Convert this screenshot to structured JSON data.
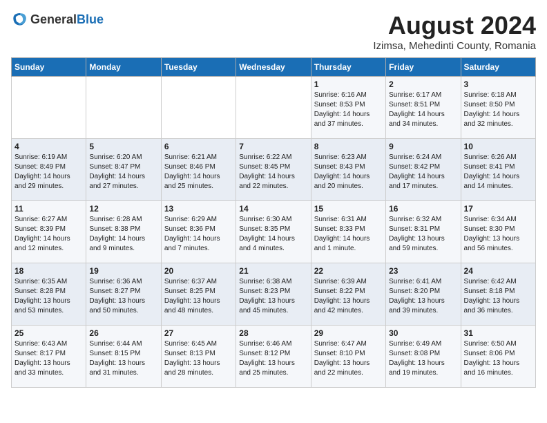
{
  "header": {
    "logo_general": "General",
    "logo_blue": "Blue",
    "title": "August 2024",
    "location": "Izimsa, Mehedinti County, Romania"
  },
  "days_of_week": [
    "Sunday",
    "Monday",
    "Tuesday",
    "Wednesday",
    "Thursday",
    "Friday",
    "Saturday"
  ],
  "weeks": [
    [
      {
        "day": "",
        "content": ""
      },
      {
        "day": "",
        "content": ""
      },
      {
        "day": "",
        "content": ""
      },
      {
        "day": "",
        "content": ""
      },
      {
        "day": "1",
        "content": "Sunrise: 6:16 AM\nSunset: 8:53 PM\nDaylight: 14 hours\nand 37 minutes."
      },
      {
        "day": "2",
        "content": "Sunrise: 6:17 AM\nSunset: 8:51 PM\nDaylight: 14 hours\nand 34 minutes."
      },
      {
        "day": "3",
        "content": "Sunrise: 6:18 AM\nSunset: 8:50 PM\nDaylight: 14 hours\nand 32 minutes."
      }
    ],
    [
      {
        "day": "4",
        "content": "Sunrise: 6:19 AM\nSunset: 8:49 PM\nDaylight: 14 hours\nand 29 minutes."
      },
      {
        "day": "5",
        "content": "Sunrise: 6:20 AM\nSunset: 8:47 PM\nDaylight: 14 hours\nand 27 minutes."
      },
      {
        "day": "6",
        "content": "Sunrise: 6:21 AM\nSunset: 8:46 PM\nDaylight: 14 hours\nand 25 minutes."
      },
      {
        "day": "7",
        "content": "Sunrise: 6:22 AM\nSunset: 8:45 PM\nDaylight: 14 hours\nand 22 minutes."
      },
      {
        "day": "8",
        "content": "Sunrise: 6:23 AM\nSunset: 8:43 PM\nDaylight: 14 hours\nand 20 minutes."
      },
      {
        "day": "9",
        "content": "Sunrise: 6:24 AM\nSunset: 8:42 PM\nDaylight: 14 hours\nand 17 minutes."
      },
      {
        "day": "10",
        "content": "Sunrise: 6:26 AM\nSunset: 8:41 PM\nDaylight: 14 hours\nand 14 minutes."
      }
    ],
    [
      {
        "day": "11",
        "content": "Sunrise: 6:27 AM\nSunset: 8:39 PM\nDaylight: 14 hours\nand 12 minutes."
      },
      {
        "day": "12",
        "content": "Sunrise: 6:28 AM\nSunset: 8:38 PM\nDaylight: 14 hours\nand 9 minutes."
      },
      {
        "day": "13",
        "content": "Sunrise: 6:29 AM\nSunset: 8:36 PM\nDaylight: 14 hours\nand 7 minutes."
      },
      {
        "day": "14",
        "content": "Sunrise: 6:30 AM\nSunset: 8:35 PM\nDaylight: 14 hours\nand 4 minutes."
      },
      {
        "day": "15",
        "content": "Sunrise: 6:31 AM\nSunset: 8:33 PM\nDaylight: 14 hours\nand 1 minute."
      },
      {
        "day": "16",
        "content": "Sunrise: 6:32 AM\nSunset: 8:31 PM\nDaylight: 13 hours\nand 59 minutes."
      },
      {
        "day": "17",
        "content": "Sunrise: 6:34 AM\nSunset: 8:30 PM\nDaylight: 13 hours\nand 56 minutes."
      }
    ],
    [
      {
        "day": "18",
        "content": "Sunrise: 6:35 AM\nSunset: 8:28 PM\nDaylight: 13 hours\nand 53 minutes."
      },
      {
        "day": "19",
        "content": "Sunrise: 6:36 AM\nSunset: 8:27 PM\nDaylight: 13 hours\nand 50 minutes."
      },
      {
        "day": "20",
        "content": "Sunrise: 6:37 AM\nSunset: 8:25 PM\nDaylight: 13 hours\nand 48 minutes."
      },
      {
        "day": "21",
        "content": "Sunrise: 6:38 AM\nSunset: 8:23 PM\nDaylight: 13 hours\nand 45 minutes."
      },
      {
        "day": "22",
        "content": "Sunrise: 6:39 AM\nSunset: 8:22 PM\nDaylight: 13 hours\nand 42 minutes."
      },
      {
        "day": "23",
        "content": "Sunrise: 6:41 AM\nSunset: 8:20 PM\nDaylight: 13 hours\nand 39 minutes."
      },
      {
        "day": "24",
        "content": "Sunrise: 6:42 AM\nSunset: 8:18 PM\nDaylight: 13 hours\nand 36 minutes."
      }
    ],
    [
      {
        "day": "25",
        "content": "Sunrise: 6:43 AM\nSunset: 8:17 PM\nDaylight: 13 hours\nand 33 minutes."
      },
      {
        "day": "26",
        "content": "Sunrise: 6:44 AM\nSunset: 8:15 PM\nDaylight: 13 hours\nand 31 minutes."
      },
      {
        "day": "27",
        "content": "Sunrise: 6:45 AM\nSunset: 8:13 PM\nDaylight: 13 hours\nand 28 minutes."
      },
      {
        "day": "28",
        "content": "Sunrise: 6:46 AM\nSunset: 8:12 PM\nDaylight: 13 hours\nand 25 minutes."
      },
      {
        "day": "29",
        "content": "Sunrise: 6:47 AM\nSunset: 8:10 PM\nDaylight: 13 hours\nand 22 minutes."
      },
      {
        "day": "30",
        "content": "Sunrise: 6:49 AM\nSunset: 8:08 PM\nDaylight: 13 hours\nand 19 minutes."
      },
      {
        "day": "31",
        "content": "Sunrise: 6:50 AM\nSunset: 8:06 PM\nDaylight: 13 hours\nand 16 minutes."
      }
    ]
  ]
}
